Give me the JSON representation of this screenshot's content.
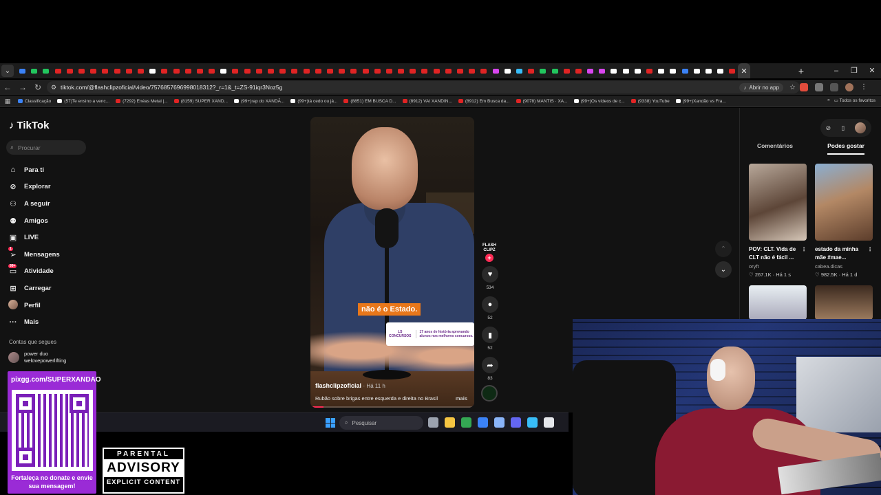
{
  "browser": {
    "tab_colors": [
      "#3b82f6",
      "#22c55e",
      "#22c55e",
      "#e02424",
      "#e02424",
      "#e02424",
      "#e02424",
      "#e02424",
      "#e02424",
      "#e02424",
      "#e02424",
      "#ffffff",
      "#e02424",
      "#e02424",
      "#e02424",
      "#e02424",
      "#e02424",
      "#ffffff",
      "#e02424",
      "#e02424",
      "#e02424",
      "#e02424",
      "#e02424",
      "#e02424",
      "#e02424",
      "#e02424",
      "#e02424",
      "#e02424",
      "#e02424",
      "#e02424",
      "#e02424",
      "#e02424",
      "#e02424",
      "#e02424",
      "#e02424",
      "#e02424",
      "#e02424",
      "#e02424",
      "#e02424",
      "#e02424",
      "#d946ef",
      "#ffffff",
      "#38bdf8",
      "#e02424",
      "#22c55e",
      "#22c55e",
      "#e02424",
      "#e02424",
      "#d946ef",
      "#d946ef",
      "#ffffff",
      "#ffffff",
      "#ffffff",
      "#e02424",
      "#ffffff",
      "#ffffff",
      "#3b82f6",
      "#ffffff",
      "#ffffff",
      "#ffffff",
      "#e02424"
    ],
    "url": "tiktok.com/@flashclipzoficial/video/7576857696998018312?_r=1&_t=ZS-91iqr3Noz5g",
    "open_app": "Abrir no app",
    "bookmarks": [
      {
        "label": "Classificação",
        "color": "#3b82f6"
      },
      {
        "label": "(57)Te ensino a venc...",
        "color": "#ffffff"
      },
      {
        "label": "(7292) Enéas Metal |...",
        "color": "#e02424"
      },
      {
        "label": "(8159) SUPER XAND...",
        "color": "#e02424"
      },
      {
        "label": "(99+)rap do XANDÃ...",
        "color": "#ffffff"
      },
      {
        "label": "(99+)tá cedo ou já...",
        "color": "#ffffff"
      },
      {
        "label": "(8851) EM BUSCA D...",
        "color": "#e02424"
      },
      {
        "label": "(8912) VAI XANDIN...",
        "color": "#e02424"
      },
      {
        "label": "(8912) Em Busca da...",
        "color": "#e02424"
      },
      {
        "label": "(9078) MANTIS · XA...",
        "color": "#e02424"
      },
      {
        "label": "(99+)Os vídeos de c...",
        "color": "#ffffff"
      },
      {
        "label": "(9338) YouTube",
        "color": "#e02424"
      },
      {
        "label": "(99+)Xandão vs Fra...",
        "color": "#ffffff"
      }
    ],
    "all_favorites": "Todos os favoritos"
  },
  "tiktok": {
    "logo": "TikTok",
    "search_placeholder": "Procurar",
    "nav": [
      {
        "icon": "home-icon",
        "glyph": "⌂",
        "label": "Para ti"
      },
      {
        "icon": "compass-icon",
        "glyph": "⊘",
        "label": "Explorar"
      },
      {
        "icon": "following-icon",
        "glyph": "⚇",
        "label": "A seguir"
      },
      {
        "icon": "friends-icon",
        "glyph": "⚉",
        "label": "Amigos"
      },
      {
        "icon": "live-icon",
        "glyph": "▣",
        "label": "LIVE"
      },
      {
        "icon": "messages-icon",
        "glyph": "➢",
        "label": "Mensagens",
        "badge": "1"
      },
      {
        "icon": "activity-icon",
        "glyph": "▭",
        "label": "Atividade",
        "badge": "99+"
      },
      {
        "icon": "upload-icon",
        "glyph": "⊞",
        "label": "Carregar"
      },
      {
        "icon": "profile-avatar",
        "glyph": "",
        "label": "Perfil"
      },
      {
        "icon": "more-icon",
        "glyph": "···",
        "label": "Mais"
      }
    ],
    "following_header": "Contas que segues",
    "following": [
      {
        "line1": "power duo",
        "line2": "welovepowerlifting"
      }
    ],
    "video": {
      "subtitle": "não é o Estado.",
      "ad_brand": "LS CONCURSOS",
      "ad_text": "17 anos de história aprovando alunos nos melhores concursos.",
      "author": "flashclipzoficial",
      "time": "· Há 11 h",
      "description": "Rubão sobre brigas entre esquerda e direita no Brasil",
      "more": "mais",
      "progress": 0.08
    },
    "creator_mark": "FLASH CLIPZ",
    "actions": [
      {
        "icon": "heart-icon",
        "glyph": "♥",
        "count": "534"
      },
      {
        "icon": "comment-icon",
        "glyph": "●",
        "count": "52"
      },
      {
        "icon": "bookmark-icon",
        "glyph": "▮",
        "count": "52"
      },
      {
        "icon": "share-icon",
        "glyph": "➦",
        "count": "83"
      }
    ],
    "right_tabs": {
      "comments": "Comentários",
      "liked": "Podes gostar"
    },
    "recommendations": [
      {
        "title": "POV: CLT. Vida de CLT não é fácil ...",
        "author": "oryft",
        "likes": "267.1K",
        "age": "Há 1 s"
      },
      {
        "title": "estado da minha mãe #mae...",
        "author": "cabea.dicas",
        "likes": "982.5K",
        "age": "Há 1 d"
      }
    ]
  },
  "taskbar": {
    "search": "Pesquisar",
    "icon_colors": [
      "#9ca3af",
      "#f5c542",
      "#34a853",
      "#3b82f6",
      "#8ab4f8",
      "#6366f1",
      "#38bdf8",
      "#e5e7eb"
    ]
  },
  "overlay": {
    "qr_url": "pixgg.com/SUPERXANDAO",
    "qr_message": "Fortaleça no donate e envie sua mensagem!",
    "pa_top": "PARENTAL",
    "pa_mid": "ADVISORY",
    "pa_bot": "EXPLICIT CONTENT"
  }
}
